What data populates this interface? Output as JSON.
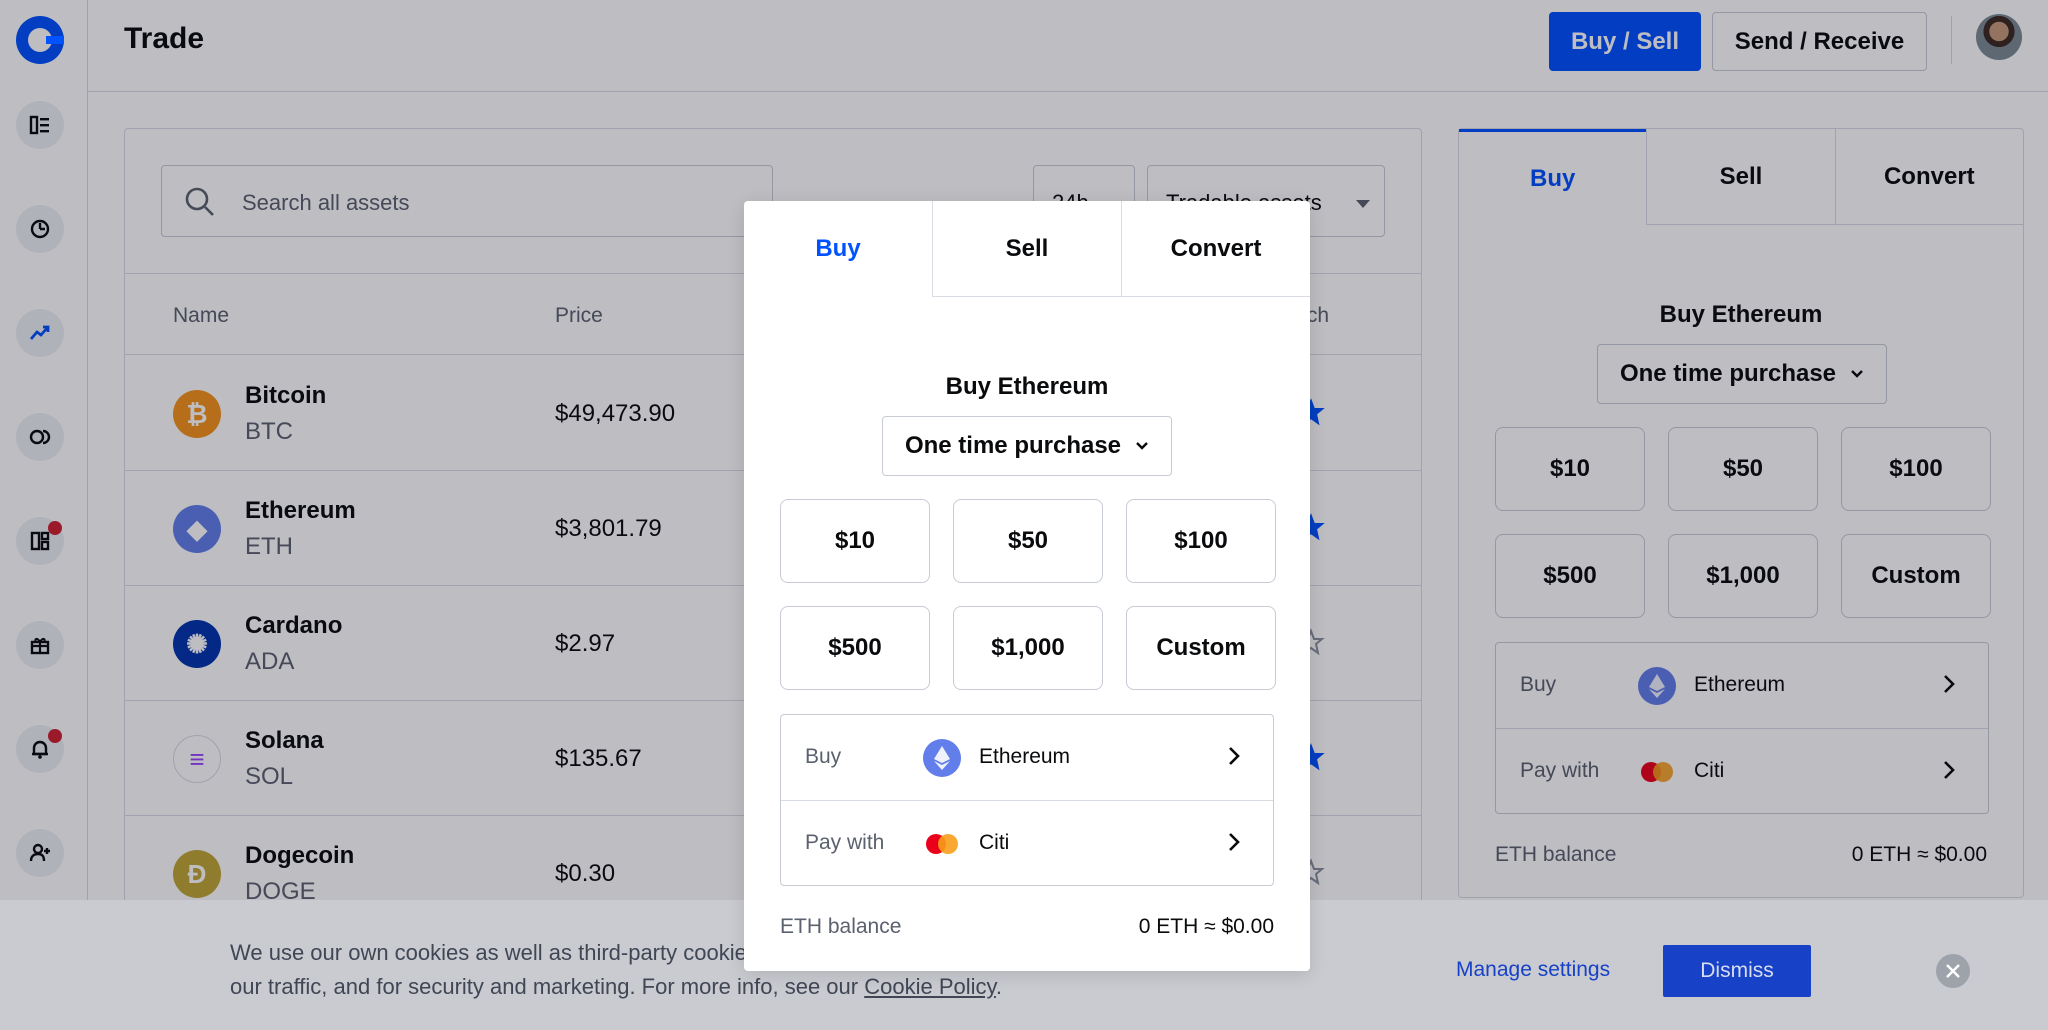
{
  "header": {
    "title": "Trade",
    "buy_sell": "Buy / Sell",
    "send_receive": "Send / Receive"
  },
  "assets": {
    "search_placeholder": "Search all assets",
    "filter_period": "24h",
    "filter_type": "Tradable assets",
    "columns": {
      "name": "Name",
      "price": "Price",
      "watch": "tch"
    },
    "rows": [
      {
        "name": "Bitcoin",
        "symbol": "BTC",
        "price": "$49,473.90",
        "icon_color": "#f7931a",
        "glyph": "₿",
        "watched": true
      },
      {
        "name": "Ethereum",
        "symbol": "ETH",
        "price": "$3,801.79",
        "icon_color": "#627eea",
        "glyph": "◆",
        "watched": true
      },
      {
        "name": "Cardano",
        "symbol": "ADA",
        "price": "$2.97",
        "icon_color": "#0033ad",
        "glyph": "✺",
        "watched": false
      },
      {
        "name": "Solana",
        "symbol": "SOL",
        "price": "$135.67",
        "icon_color": "#ffffff",
        "glyph": "≡",
        "watched": true
      },
      {
        "name": "Dogecoin",
        "symbol": "DOGE",
        "price": "$0.30",
        "icon_color": "#c2a633",
        "glyph": "Ð",
        "watched": false
      }
    ]
  },
  "trade": {
    "tabs": {
      "buy": "Buy",
      "sell": "Sell",
      "convert": "Convert"
    },
    "title": "Buy Ethereum",
    "frequency": "One time purchase",
    "amounts": [
      "$10",
      "$50",
      "$100",
      "$500",
      "$1,000",
      "Custom"
    ],
    "buy_label": "Buy",
    "buy_asset": "Ethereum",
    "pay_label": "Pay with",
    "pay_method": "Citi",
    "balance_label": "ETH balance",
    "balance_value": "0 ETH ≈ $0.00"
  },
  "cookie": {
    "text_part1": "We use our own cookies as well as third-party cookies on our websites to enhance your experience, analyze our traffic, and for security and marketing. For more info, see our ",
    "policy_link": "Cookie Policy",
    "text_part2": ".",
    "manage": "Manage settings",
    "dismiss": "Dismiss"
  },
  "colors": {
    "brand": "#0052ff",
    "alert": "#cf202f"
  }
}
